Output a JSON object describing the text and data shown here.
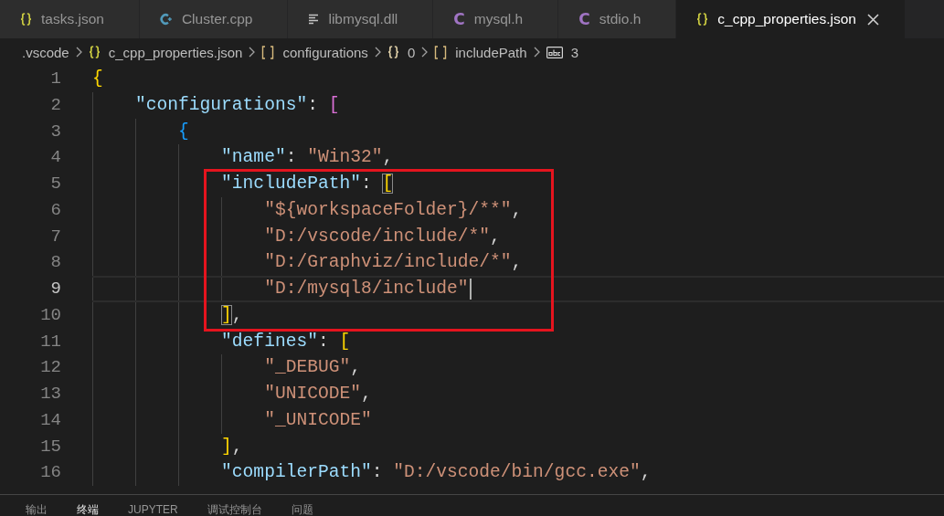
{
  "tabs": [
    {
      "label": "tasks.json",
      "kind": "json",
      "selected": false
    },
    {
      "label": "Cluster.cpp",
      "kind": "cpp",
      "selected": false
    },
    {
      "label": "libmysql.dll",
      "kind": "text",
      "selected": false
    },
    {
      "label": "mysql.h",
      "kind": "c",
      "icon": "C",
      "selected": false
    },
    {
      "label": "stdio.h",
      "kind": "c",
      "icon": "C",
      "selected": false
    },
    {
      "label": "c_cpp_properties.json",
      "kind": "json",
      "selected": true
    }
  ],
  "breadcrumb": [
    {
      "label": ".vscode",
      "kind": "folder"
    },
    {
      "label": "c_cpp_properties.json",
      "kind": "file"
    },
    {
      "label": "configurations",
      "kind": "array"
    },
    {
      "label": "0",
      "kind": "object"
    },
    {
      "label": "includePath",
      "kind": "array"
    },
    {
      "label": "3",
      "kind": "string"
    }
  ],
  "editor": {
    "lines": [
      {
        "kind": "line",
        "number": "1",
        "current": false,
        "tokens": [
          {
            "kind": "bracket",
            "text": "{"
          }
        ],
        "children": [
          {
            "kind": "line",
            "number": "2",
            "current": false,
            "tokens": [
              {
                "kind": "key",
                "text": "\"configurations\""
              },
              {
                "kind": "punct",
                "text": ": "
              },
              {
                "kind": "bracket",
                "text": "["
              }
            ],
            "children": [
              {
                "kind": "line",
                "number": "3",
                "current": false,
                "tokens": [
                  {
                    "kind": "bracket",
                    "text": "{"
                  }
                ],
                "children": [
                  {
                    "kind": "line",
                    "number": "4",
                    "current": false,
                    "tokens": [
                      {
                        "kind": "key",
                        "text": "\"name\""
                      },
                      {
                        "kind": "punct",
                        "text": ": "
                      },
                      {
                        "kind": "string",
                        "text": "\"Win32\""
                      },
                      {
                        "kind": "punct",
                        "text": ","
                      }
                    ]
                  },
                  {
                    "kind": "annotation",
                    "children": [
                      {
                        "kind": "line",
                        "number": "5",
                        "current": false,
                        "tokens": [
                          {
                            "kind": "key",
                            "text": "\"includePath\""
                          },
                          {
                            "kind": "punct",
                            "text": ": "
                          },
                          {
                            "kind": "match",
                            "text": "["
                          }
                        ],
                        "children": [
                          {
                            "kind": "line",
                            "number": "6",
                            "current": false,
                            "tokens": [
                              {
                                "kind": "string",
                                "text": "\"${workspaceFolder}/**\""
                              },
                              {
                                "kind": "punct",
                                "text": ","
                              }
                            ]
                          },
                          {
                            "kind": "line",
                            "number": "7",
                            "current": false,
                            "tokens": [
                              {
                                "kind": "string",
                                "text": "\"D:/vscode/include/*\""
                              },
                              {
                                "kind": "punct",
                                "text": ","
                              }
                            ]
                          },
                          {
                            "kind": "line",
                            "number": "8",
                            "current": false,
                            "tokens": [
                              {
                                "kind": "string",
                                "text": "\"D:/Graphviz/include/*\""
                              },
                              {
                                "kind": "punct",
                                "text": ","
                              }
                            ]
                          },
                          {
                            "kind": "line",
                            "number": "9",
                            "current": true,
                            "tokens": [
                              {
                                "kind": "string",
                                "text": "\"D:/mysql8/include\""
                              }
                            ]
                          }
                        ]
                      },
                      {
                        "kind": "line",
                        "number": "10",
                        "current": false,
                        "tokens": [
                          {
                            "kind": "match",
                            "text": "]"
                          },
                          {
                            "kind": "punct",
                            "text": ","
                          }
                        ]
                      }
                    ]
                  },
                  {
                    "kind": "line",
                    "number": "11",
                    "current": false,
                    "tokens": [
                      {
                        "kind": "key",
                        "text": "\"defines\""
                      },
                      {
                        "kind": "punct",
                        "text": ": "
                      },
                      {
                        "kind": "bracket",
                        "text": "["
                      }
                    ],
                    "children": [
                      {
                        "kind": "line",
                        "number": "12",
                        "current": false,
                        "tokens": [
                          {
                            "kind": "string",
                            "text": "\"_DEBUG\""
                          },
                          {
                            "kind": "punct",
                            "text": ","
                          }
                        ]
                      },
                      {
                        "kind": "line",
                        "number": "13",
                        "current": false,
                        "tokens": [
                          {
                            "kind": "string",
                            "text": "\"UNICODE\""
                          },
                          {
                            "kind": "punct",
                            "text": ","
                          }
                        ]
                      },
                      {
                        "kind": "line",
                        "number": "14",
                        "current": false,
                        "tokens": [
                          {
                            "kind": "string",
                            "text": "\"_UNICODE\""
                          }
                        ]
                      }
                    ]
                  },
                  {
                    "kind": "line",
                    "number": "15",
                    "current": false,
                    "tokens": [
                      {
                        "kind": "bracket",
                        "text": "]"
                      },
                      {
                        "kind": "punct",
                        "text": ","
                      }
                    ]
                  },
                  {
                    "kind": "line",
                    "number": "16",
                    "current": false,
                    "tokens": [
                      {
                        "kind": "key",
                        "text": "\"compilerPath\""
                      },
                      {
                        "kind": "punct",
                        "text": ": "
                      },
                      {
                        "kind": "string",
                        "text": "\"D:/vscode/bin/gcc.exe\""
                      },
                      {
                        "kind": "punct",
                        "text": ","
                      }
                    ]
                  }
                ]
              }
            ]
          }
        ]
      }
    ]
  },
  "panel": {
    "tabs": [
      {
        "label": "输出",
        "selected": false
      },
      {
        "label": "终端",
        "selected": true
      },
      {
        "label": "JUPYTER",
        "selected": false
      },
      {
        "label": "调试控制台",
        "selected": false
      },
      {
        "label": "问题",
        "selected": false
      }
    ]
  }
}
